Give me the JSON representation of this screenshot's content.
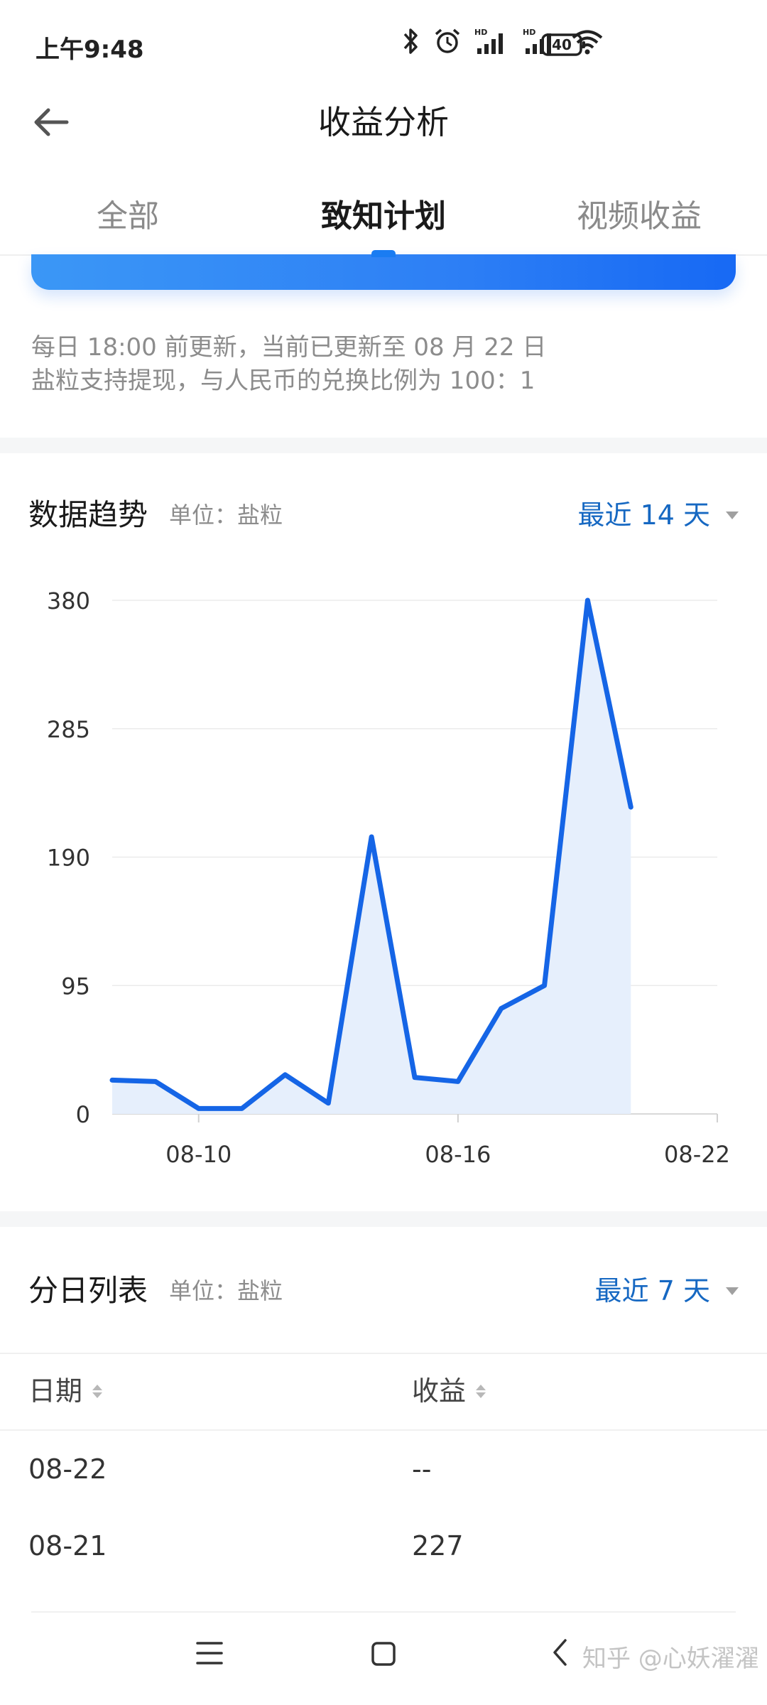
{
  "status_bar": {
    "time": "上午9:48",
    "battery": "40",
    "icons": [
      "bluetooth-icon",
      "alarm-icon",
      "signal-hd-icon",
      "signal-hd-icon",
      "wifi-icon",
      "battery-icon"
    ]
  },
  "header": {
    "back_icon": "arrow-left-icon",
    "title": "收益分析"
  },
  "tabs": [
    {
      "label": "全部",
      "active": false
    },
    {
      "label": "致知计划",
      "active": true
    },
    {
      "label": "视频收益",
      "active": false
    }
  ],
  "notes": {
    "line1": "每日 18:00 前更新，当前已更新至 08 月 22 日",
    "line2": "盐粒支持提现，与人民币的兑换比例为 100：1"
  },
  "trend": {
    "title": "数据趋势",
    "unit": "单位：盐粒",
    "range": "最近 14 天"
  },
  "chart_data": {
    "type": "area",
    "x": [
      "08-08",
      "08-09",
      "08-10",
      "08-11",
      "08-12",
      "08-13",
      "08-14",
      "08-15",
      "08-16",
      "08-17",
      "08-18",
      "08-19",
      "08-20",
      "08-21"
    ],
    "series": [
      {
        "values": [
          25,
          24,
          4,
          4,
          29,
          8,
          205,
          27,
          24,
          78,
          95,
          380,
          227,
          null
        ]
      }
    ],
    "x_ticks": [
      "08-10",
      "08-16",
      "08-22"
    ],
    "y_ticks": [
      0,
      95,
      190,
      285,
      380
    ],
    "ylim": [
      0,
      380
    ],
    "grid": true,
    "line_color": "#1565e6",
    "fill_color": "#e6effc"
  },
  "daily": {
    "title": "分日列表",
    "unit": "单位：盐粒",
    "range": "最近 7 天",
    "columns": [
      "日期",
      "收益"
    ],
    "rows": [
      {
        "date": "08-22",
        "value": "--"
      },
      {
        "date": "08-21",
        "value": "227"
      }
    ]
  },
  "nav": {
    "icons": [
      "menu-icon",
      "home-icon",
      "back-icon"
    ]
  },
  "watermark": "知乎 @心妖濯濯"
}
